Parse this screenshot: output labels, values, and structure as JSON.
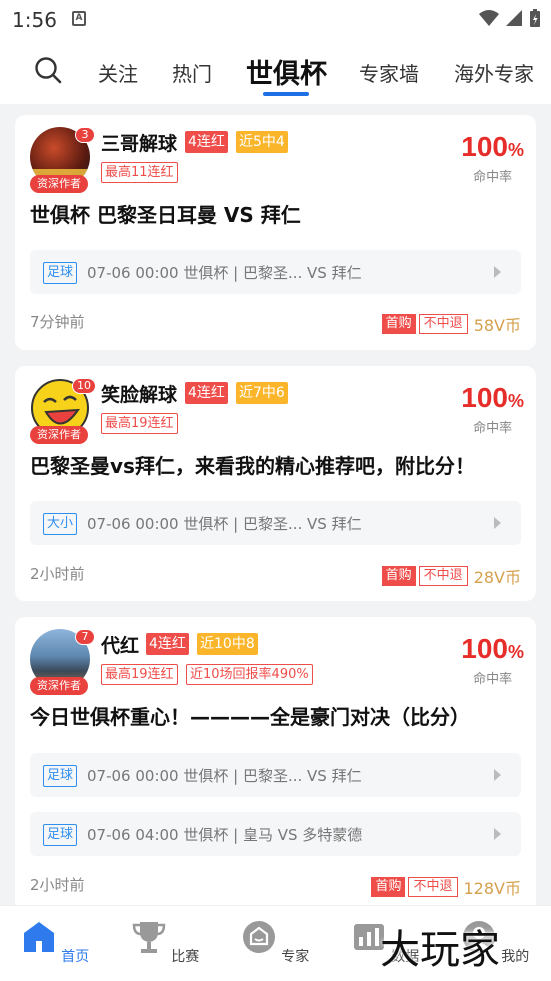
{
  "status_bar": {
    "time": "1:56",
    "notif_icon": "A"
  },
  "nav": {
    "tabs": [
      {
        "label": "关注"
      },
      {
        "label": "热门"
      },
      {
        "label": "世俱杯"
      },
      {
        "label": "专家墙"
      },
      {
        "label": "海外专家"
      }
    ]
  },
  "cards": [
    {
      "badge": "3",
      "senior": "资深作者",
      "name": "三哥解球",
      "streak": "4连红",
      "recent": "近5中4",
      "best": "最高11连红",
      "rate": "100",
      "rate_unit": "%",
      "rate_label": "命中率",
      "title": "世俱杯 巴黎圣日耳曼 VS 拜仁",
      "matches": [
        {
          "tag": "足球",
          "text": "07-06 00:00 世俱杯 | 巴黎圣... VS 拜仁"
        }
      ],
      "time_ago": "7分钟前",
      "buy": "首购",
      "no_refund": "不中退",
      "price": "58V币"
    },
    {
      "badge": "10",
      "senior": "资深作者",
      "name": "笑脸解球",
      "streak": "4连红",
      "recent": "近7中6",
      "best": "最高19连红",
      "rate": "100",
      "rate_unit": "%",
      "rate_label": "命中率",
      "title": "巴黎圣曼vs拜仁，来看我的精心推荐吧，附比分！",
      "matches": [
        {
          "tag": "大小",
          "text": "07-06 00:00 世俱杯 | 巴黎圣... VS 拜仁"
        }
      ],
      "time_ago": "2小时前",
      "buy": "首购",
      "no_refund": "不中退",
      "price": "28V币"
    },
    {
      "badge": "7",
      "senior": "资深作者",
      "name": "代红",
      "streak": "4连红",
      "recent": "近10中8",
      "best": "最高19连红",
      "return_rate": "近10场回报率490%",
      "rate": "100",
      "rate_unit": "%",
      "rate_label": "命中率",
      "title": "今日世俱杯重心！————全是豪门对决（比分）",
      "matches": [
        {
          "tag": "足球",
          "text": "07-06 00:00 世俱杯 | 巴黎圣... VS 拜仁"
        },
        {
          "tag": "足球",
          "text": "07-06 04:00 世俱杯 | 皇马 VS 多特蒙德"
        }
      ],
      "time_ago": "2小时前",
      "buy": "首购",
      "no_refund": "不中退",
      "price": "128V币"
    }
  ],
  "bottom_nav": [
    {
      "label": "首页",
      "icon": "home-icon"
    },
    {
      "label": "比赛",
      "icon": "trophy-icon"
    },
    {
      "label": "专家",
      "icon": "expert-icon"
    },
    {
      "label": "数据",
      "icon": "data-icon"
    },
    {
      "label": "我的",
      "icon": "profile-icon"
    }
  ],
  "watermark": "大玩家",
  "colors": {
    "accent": "#1e6fe6",
    "red": "#e62d2a",
    "gold": "#d6a14f"
  }
}
